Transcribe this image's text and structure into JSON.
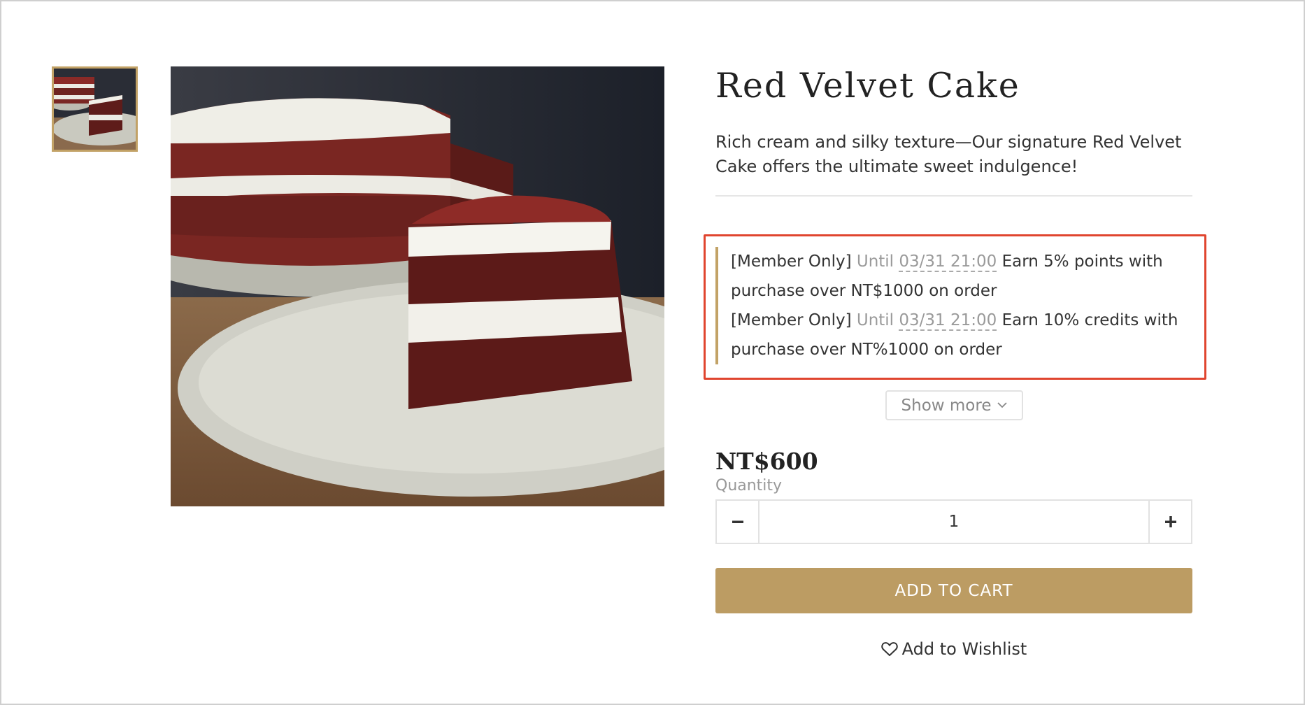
{
  "product": {
    "title": "Red Velvet Cake",
    "description": "Rich cream and silky texture—Our signature Red Velvet Cake offers the ultimate sweet indulgence!",
    "price": "NT$600"
  },
  "promotions": [
    {
      "tag": "[Member Only]",
      "until_label": "Until",
      "date": "03/31 21:00",
      "text_a": "Earn 5% points with",
      "text_b": "purchase over NT$1000 on order"
    },
    {
      "tag": "[Member Only]",
      "until_label": "Until",
      "date": "03/31 21:00",
      "text_a": "Earn 10% credits with",
      "text_b": "purchase over NT%1000 on order"
    }
  ],
  "show_more_label": "Show more",
  "quantity": {
    "label": "Quantity",
    "value": "1"
  },
  "add_to_cart_label": "ADD TO CART",
  "wishlist_label": "Add to Wishlist",
  "colors": {
    "accent_gold": "#bc9c63",
    "highlight_red": "#e0452f"
  },
  "icons": {
    "minus": "minus-icon",
    "plus": "plus-icon",
    "chevron": "chevron-down-icon",
    "heart": "heart-icon"
  }
}
